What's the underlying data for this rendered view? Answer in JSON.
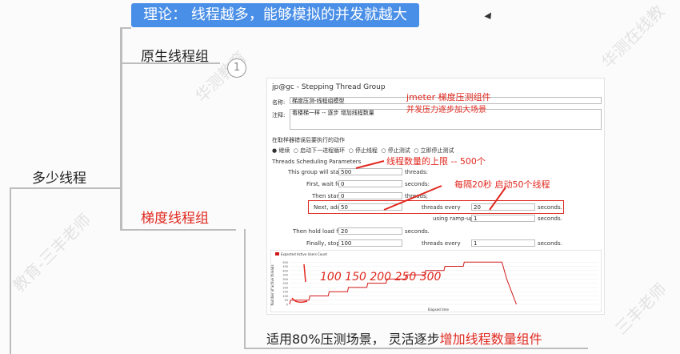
{
  "mindmap": {
    "banner": "理论：  线程越多，能够模拟的并发就越大",
    "node_native": "原生线程组",
    "node_count": "多少线程",
    "node_stepping": "梯度线程组",
    "badge": "1",
    "bottom_prefix": "适用80%压测场景，  灵活逐步",
    "bottom_highlight": "增加线程数量组件"
  },
  "jmeter": {
    "title": "jp@gc - Stepping Thread Group",
    "name_label": "名称:",
    "name_value": "梯度压测-线程组模型",
    "comment_label": "注释:",
    "comment_value": "看楼梯一样 -- 逐步 增加线程数量",
    "sampler_error_label": "在取样器错误后要执行的动作",
    "actions": [
      "继续",
      "启动下一进程循环",
      "停止线程",
      "停止测试",
      "立即停止测试"
    ],
    "params_header": "Threads Scheduling Parameters",
    "rows": {
      "start_label": "This group will start",
      "start_value": "500",
      "start_unit": "threads:",
      "wait_label": "First, wait for",
      "wait_value": "0",
      "wait_unit": "seconds:",
      "then_start_label": "Then start",
      "then_start_value": "0",
      "then_start_unit": "threads;",
      "next_label": "Next, add",
      "next_value": "50",
      "every_label": "threads every",
      "every_value": "20",
      "every_unit": "seconds.",
      "rampup_label": "using ramp-up",
      "rampup_value": "1",
      "rampup_unit": "seconds.",
      "hold_label": "Then hold load for",
      "hold_value": "20",
      "hold_unit": "seconds.",
      "stop_label": "Finally, stop",
      "stop_value": "100",
      "stop_every_label": "threads every",
      "stop_every_value": "1",
      "stop_every_unit": "seconds."
    },
    "chart_legend": "Expected Active Users Count",
    "chart_ylabel": "Number of active threads",
    "chart_xlabel": "Elapsed time"
  },
  "annotations": {
    "component": "jmeter  梯度压测组件",
    "component_sub": "并发压力逐步加大场景",
    "upper_limit": "线程数量的上限 -- 500个",
    "every20": "每隔20秒 启动50个线程",
    "handwriting": "100   150   200  250  300"
  },
  "colors": {
    "banner": "#4a8fe7",
    "accent_red": "#e0281f",
    "chart_line": "#d01818"
  },
  "chart_data": {
    "type": "line",
    "title": "",
    "xlabel": "Elapsed time",
    "ylabel": "Number of active threads",
    "ylim": [
      0,
      550
    ],
    "xlim": [
      0,
      320
    ],
    "yticks": [
      0,
      50,
      100,
      150,
      200,
      250,
      300,
      350,
      400,
      450,
      500
    ],
    "series": [
      {
        "name": "Expected Active Users Count",
        "points": [
          [
            0,
            0
          ],
          [
            1,
            50
          ],
          [
            20,
            50
          ],
          [
            21,
            100
          ],
          [
            40,
            100
          ],
          [
            41,
            150
          ],
          [
            60,
            150
          ],
          [
            61,
            200
          ],
          [
            80,
            200
          ],
          [
            81,
            250
          ],
          [
            100,
            250
          ],
          [
            101,
            300
          ],
          [
            120,
            300
          ],
          [
            121,
            350
          ],
          [
            140,
            350
          ],
          [
            141,
            400
          ],
          [
            160,
            400
          ],
          [
            161,
            450
          ],
          [
            180,
            450
          ],
          [
            181,
            500
          ],
          [
            200,
            500
          ],
          [
            201,
            500
          ],
          [
            220,
            500
          ],
          [
            225,
            300
          ],
          [
            230,
            150
          ],
          [
            235,
            0
          ]
        ]
      }
    ]
  }
}
